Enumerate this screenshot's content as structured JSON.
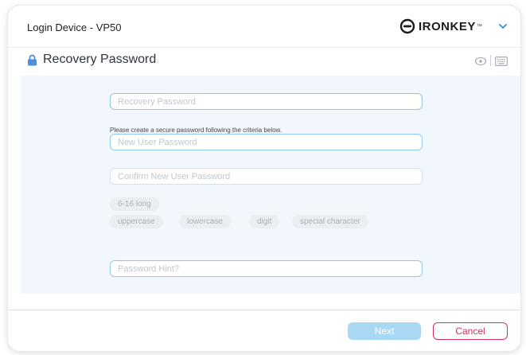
{
  "window": {
    "title": "Login Device - VP50",
    "brand": {
      "name": "IRONKEY",
      "trademark": "™"
    }
  },
  "section": {
    "title": "Recovery Password"
  },
  "form": {
    "recovery_password": {
      "placeholder": "Recovery Password",
      "value": ""
    },
    "instruction": "Please create a secure password following the criteria below.",
    "new_password": {
      "placeholder": "New User Password",
      "value": ""
    },
    "confirm_password": {
      "placeholder": "Confirm New User Password",
      "value": ""
    },
    "criteria": {
      "length": "6-16 long",
      "uppercase": "uppercase",
      "lowercase": "lowercase",
      "digit": "digit",
      "special": "special character"
    },
    "password_hint": {
      "placeholder": "Password Hint?",
      "value": ""
    }
  },
  "footer": {
    "next_label": "Next",
    "cancel_label": "Cancel"
  },
  "colors": {
    "accent": "#8fc9ee",
    "next_disabled": "#a9d8f5",
    "cancel": "#d72e5b",
    "panel_bg": "#f2f7fd"
  },
  "icons": [
    "ironkey-logo-icon",
    "chevron-down-icon",
    "lock-icon",
    "eye-icon",
    "keyboard-icon"
  ]
}
